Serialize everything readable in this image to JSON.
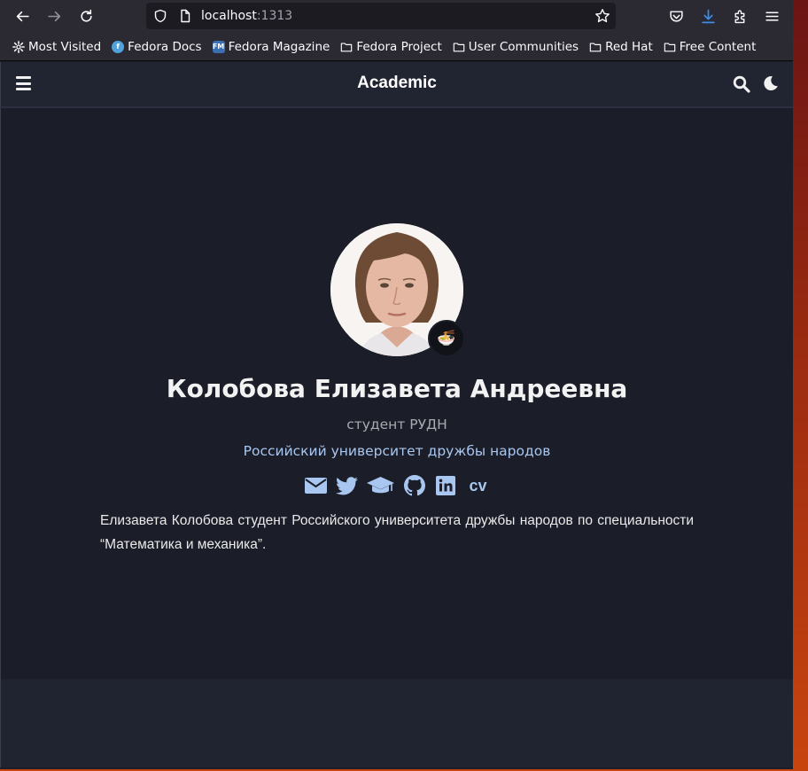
{
  "browser": {
    "url_host": "localhost",
    "url_port": ":1313",
    "bookmarks": [
      {
        "label": "Most Visited",
        "icon": "gear-icon"
      },
      {
        "label": "Fedora Docs",
        "icon": "fedora-icon"
      },
      {
        "label": "Fedora Magazine",
        "icon": "fm-icon",
        "badge": "FM"
      },
      {
        "label": "Fedora Project",
        "icon": "folder-icon"
      },
      {
        "label": "User Communities",
        "icon": "folder-icon"
      },
      {
        "label": "Red Hat",
        "icon": "folder-icon"
      },
      {
        "label": "Free Content",
        "icon": "folder-icon"
      }
    ]
  },
  "navbar": {
    "brand": "Academic"
  },
  "profile": {
    "name": "Колобова Елизавета Андреевна",
    "role": "студент РУДН",
    "organization": "Российский университет дружбы народов",
    "avatar_badge_emoji": "🍜",
    "social_links": [
      "envelope-icon",
      "twitter-icon",
      "graduation-cap-icon",
      "github-icon",
      "linkedin-icon",
      "cv-icon"
    ],
    "cv_label": "cv",
    "bio": "Елизавета Колобова студент Российского университета дружбы народов по специальности “Математика и механика”."
  },
  "colors": {
    "accent": "#a8c6ef",
    "background": "#1b1e29",
    "navbar": "#212431"
  }
}
